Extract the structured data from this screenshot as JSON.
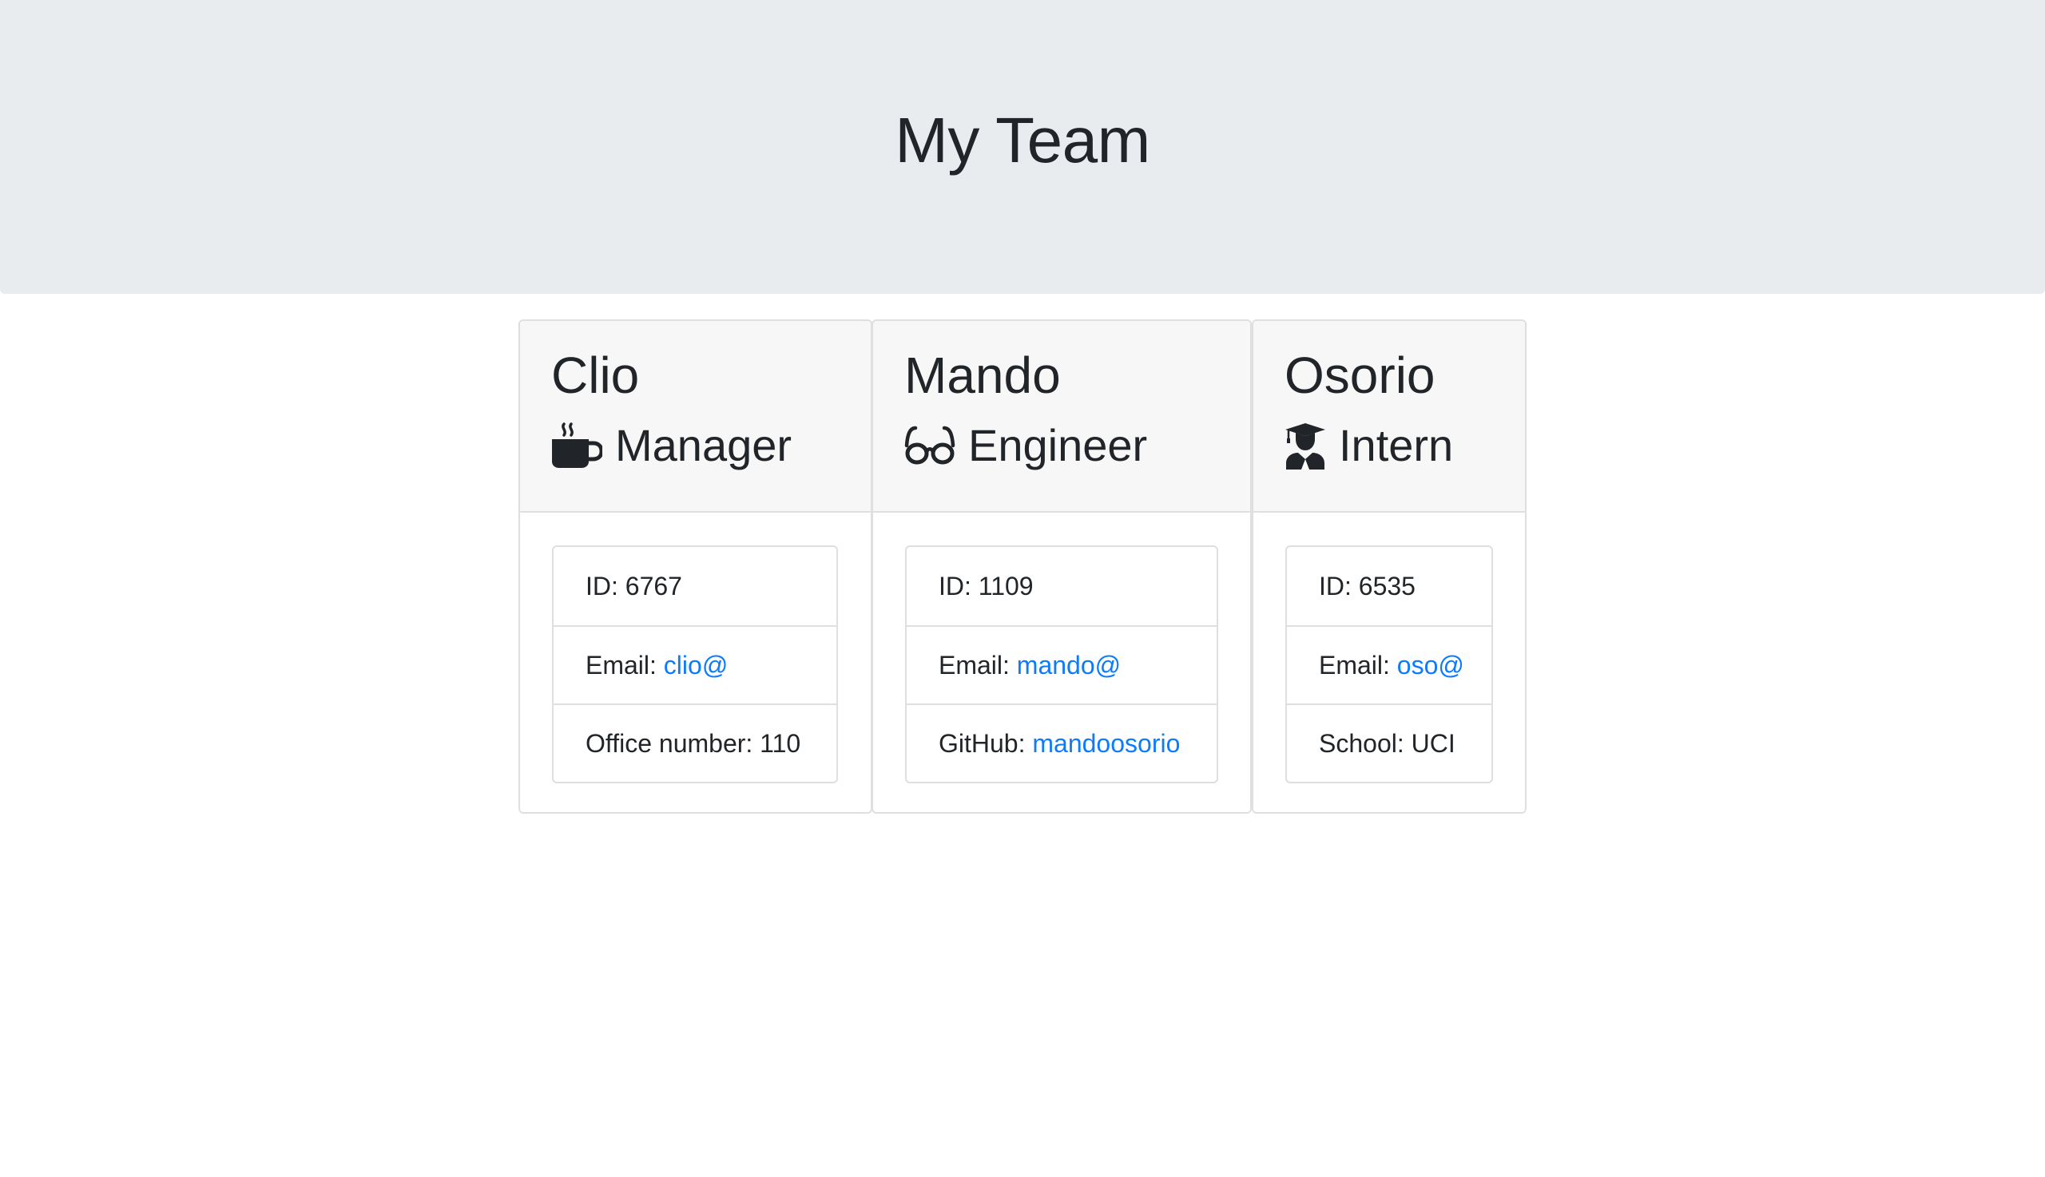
{
  "header": {
    "title": "My Team"
  },
  "colors": {
    "jumbotron_bg": "#e9ecef",
    "card_header_bg": "#f7f7f7",
    "link": "#0d7bfe",
    "text": "#212529"
  },
  "cards": [
    {
      "name": "Clio",
      "role": "Manager",
      "role_icon": "coffee-mug-icon",
      "id_text": "ID: 6767",
      "email_prefix": "Email: ",
      "email_link": "clio@",
      "extra_label": "Office number: 110",
      "extra_link": ""
    },
    {
      "name": "Mando",
      "role": "Engineer",
      "role_icon": "glasses-icon",
      "id_text": "ID: 1109",
      "email_prefix": "Email: ",
      "email_link": "mando@",
      "extra_label": "GitHub: ",
      "extra_link": "mandoosorio"
    },
    {
      "name": "Osorio",
      "role": "Intern",
      "role_icon": "graduate-icon",
      "id_text": "ID: 6535",
      "email_prefix": "Email: ",
      "email_link": "oso@",
      "extra_label": "School: UCI",
      "extra_link": ""
    }
  ]
}
